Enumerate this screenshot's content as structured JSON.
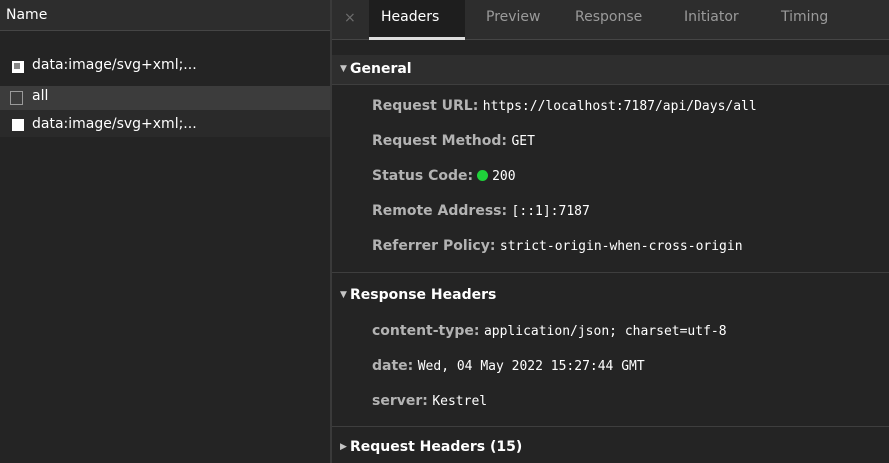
{
  "request_list": {
    "column_header": "Name",
    "rows": [
      {
        "label": "data:image/svg+xml;...",
        "icon": "svg-file-icon"
      },
      {
        "label": "all",
        "icon": "empty-file-icon"
      },
      {
        "label": "data:image/svg+xml;...",
        "icon": "white-file-icon"
      }
    ]
  },
  "tabs": {
    "close": "×",
    "items": [
      "Headers",
      "Preview",
      "Response",
      "Initiator",
      "Timing"
    ],
    "active": "Headers"
  },
  "general": {
    "title": "General",
    "rows": [
      {
        "key": "Request URL:",
        "value": "https://localhost:7187/api/Days/all"
      },
      {
        "key": "Request Method:",
        "value": "GET"
      },
      {
        "key": "Status Code:",
        "value": "200"
      },
      {
        "key": "Remote Address:",
        "value": "[::1]:7187"
      },
      {
        "key": "Referrer Policy:",
        "value": "strict-origin-when-cross-origin"
      }
    ]
  },
  "response_headers": {
    "title": "Response Headers",
    "rows": [
      {
        "key": "content-type:",
        "value": "application/json; charset=utf-8"
      },
      {
        "key": "date:",
        "value": "Wed, 04 May 2022 15:27:44 GMT"
      },
      {
        "key": "server:",
        "value": "Kestrel"
      }
    ]
  },
  "request_headers": {
    "title": "Request Headers (15)"
  },
  "colors": {
    "background": "#242424",
    "panel_header": "#2d2d2d",
    "selected_row": "#3c3c3c",
    "status_ok": "#1fd13a"
  }
}
